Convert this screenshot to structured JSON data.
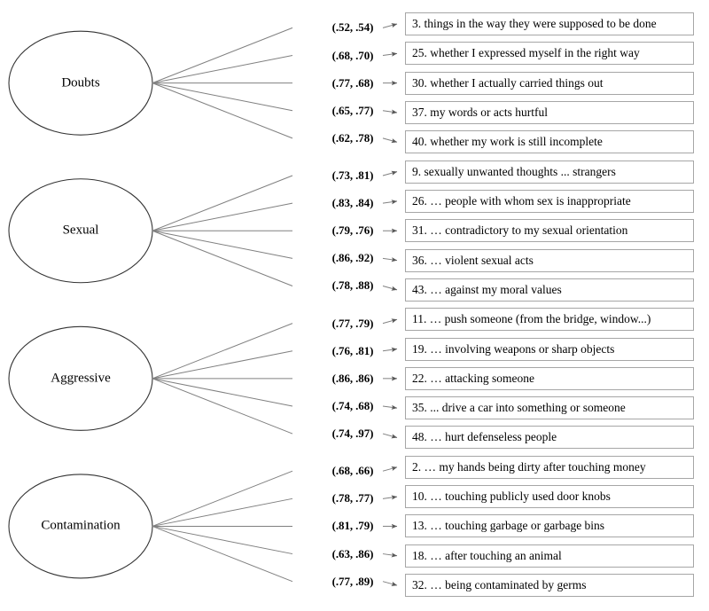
{
  "figure": {
    "type": "cfa-path-diagram",
    "factor_count": 4,
    "indicators_per_factor": 5,
    "edge_color": "#808080",
    "box_border_color": "#a6a6a6",
    "ellipse_border_color": "#333333"
  },
  "factors": [
    {
      "name": "Doubts",
      "label": "Doubts",
      "loadings": [
        {
          "coef": "(.52, .54)",
          "item": "3. things in the way they were supposed to be done"
        },
        {
          "coef": "(.68, .70)",
          "item": "25. whether I expressed myself in the right way"
        },
        {
          "coef": "(.77, .68)",
          "item": "30. whether I actually carried things out"
        },
        {
          "coef": "(.65, .77)",
          "item": "37. my words or acts hurtful"
        },
        {
          "coef": "(.62, .78)",
          "item": "40. whether my work is still incomplete"
        }
      ]
    },
    {
      "name": "Sexual",
      "label": "Sexual",
      "loadings": [
        {
          "coef": "(.73, .81)",
          "item": "9. sexually unwanted thoughts ... strangers"
        },
        {
          "coef": "(.83, .84)",
          "item": "26. … people with whom sex is inappropriate"
        },
        {
          "coef": "(.79, .76)",
          "item": "31. … contradictory to my sexual orientation"
        },
        {
          "coef": "(.86, .92)",
          "item": "36.  … violent sexual acts"
        },
        {
          "coef": "(.78, .88)",
          "item": "43. … against my moral values"
        }
      ]
    },
    {
      "name": "Aggressive",
      "label": "Aggressive",
      "loadings": [
        {
          "coef": "(.77, .79)",
          "item": "11. … push someone (from the bridge, window...)"
        },
        {
          "coef": "(.76, .81)",
          "item": "19. … involving weapons or sharp objects"
        },
        {
          "coef": "(.86, .86)",
          "item": "22. … attacking someone"
        },
        {
          "coef": "(.74, .68)",
          "item": "35. ... drive a car into something or someone"
        },
        {
          "coef": "(.74, .97)",
          "item": "48. … hurt defenseless people"
        }
      ]
    },
    {
      "name": "Contamination",
      "label": "Contamination",
      "loadings": [
        {
          "coef": "(.68, .66)",
          "item": "2. …  my hands being dirty after touching money"
        },
        {
          "coef": "(.78, .77)",
          "item": "10. … touching publicly used door knobs"
        },
        {
          "coef": "(.81, .79)",
          "item": "13. … touching garbage or garbage bins"
        },
        {
          "coef": "(.63, .86)",
          "item": "18. … after touching an animal"
        },
        {
          "coef": "(.77, .89)",
          "item": "32. … being contaminated by germs"
        }
      ]
    }
  ]
}
